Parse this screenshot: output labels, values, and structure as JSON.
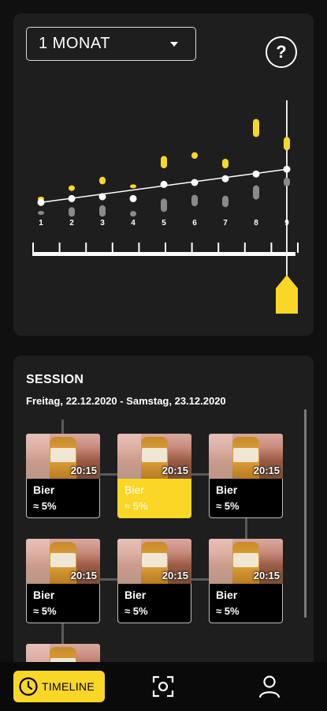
{
  "chart": {
    "period_label": "1 MONAT",
    "help_label": "?",
    "accent_color": "#fad726",
    "x_labels": [
      "1",
      "2",
      "3",
      "4",
      "5",
      "6",
      "7",
      "8",
      "9"
    ],
    "selected_day": "9",
    "chart_data": {
      "type": "scatter",
      "title": "",
      "xlabel": "",
      "ylabel": "",
      "categories": [
        "1",
        "2",
        "3",
        "4",
        "5",
        "6",
        "7",
        "8",
        "9"
      ],
      "series": [
        {
          "values": [
            [
              0.14,
              0.15
            ],
            [
              0.21,
              0.27
            ],
            [
              0.28,
              0.36
            ],
            [
              0.24,
              0.28
            ],
            [
              0.45,
              0.58
            ],
            [
              0.55,
              0.62
            ],
            [
              0.45,
              0.55
            ],
            [
              0.78,
              0.97
            ],
            [
              0.64,
              0.78
            ]
          ]
        },
        {
          "values": [
            0.09,
            0.13,
            0.15,
            0.13,
            0.28,
            0.3,
            0.34,
            0.39,
            0.44
          ]
        },
        {
          "values": [
            [
              -0.04,
              0.0
            ],
            [
              -0.06,
              0.04
            ],
            [
              -0.06,
              0.06
            ],
            [
              -0.06,
              0.0
            ],
            [
              -0.01,
              0.13
            ],
            [
              0.05,
              0.17
            ],
            [
              0.04,
              0.16
            ],
            [
              0.12,
              0.27
            ],
            [
              0.26,
              0.35
            ]
          ]
        }
      ],
      "trend": [
        0.09,
        0.44
      ],
      "ylim": [
        -0.1,
        1.0
      ]
    }
  },
  "session": {
    "title": "SESSION",
    "dates": "Freitag, 22.12.2020 - Samstag, 23.12.2020",
    "entries": [
      {
        "time": "20:15",
        "name": "Bier",
        "pct": "≈ 5%"
      },
      {
        "time": "20:15",
        "name": "Bier",
        "pct": "≈ 5%"
      },
      {
        "time": "20:15",
        "name": "Bier",
        "pct": "≈ 5%"
      },
      {
        "time": "20:15",
        "name": "Bier",
        "pct": "≈ 5%"
      },
      {
        "time": "20:15",
        "name": "Bier",
        "pct": "≈ 5%"
      },
      {
        "time": "20:15",
        "name": "Bier",
        "pct": "≈ 5%"
      }
    ]
  },
  "nav": {
    "timeline_label": "TIMELINE",
    "icons": [
      "clock-icon",
      "scan-icon",
      "user-icon"
    ]
  }
}
